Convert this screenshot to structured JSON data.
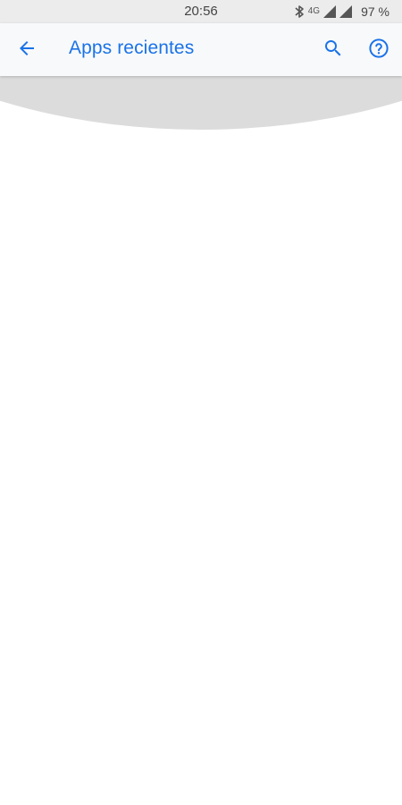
{
  "status_bar": {
    "time": "20:56",
    "network": "4G",
    "battery": "97 %"
  },
  "toolbar": {
    "title": "Apps recientes",
    "back_icon": "arrow-back-icon",
    "search_icon": "search-icon",
    "help_icon": "help-circle-icon"
  },
  "colors": {
    "accent": "#1a73e8",
    "toolbar_bg": "#f8f9fa",
    "status_bg": "#ececec",
    "backdrop": "#dcdcdc"
  }
}
